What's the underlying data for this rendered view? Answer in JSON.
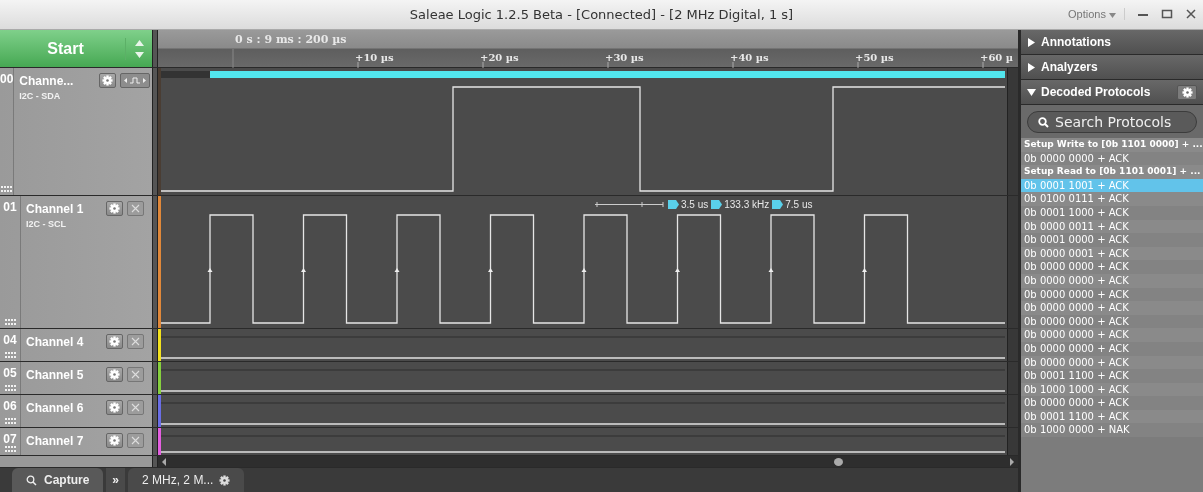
{
  "window": {
    "title": "Saleae Logic 1.2.5 Beta - [Connected] - [2 MHz Digital, 1 s]",
    "options": "Options"
  },
  "start_button": "Start",
  "timeline": {
    "origin": "0 s : 9 ms : 200 µs",
    "ticks": [
      "+10 µs",
      "+20 µs",
      "+30 µs",
      "+40 µs",
      "+50 µs",
      "+60 µ"
    ]
  },
  "channels": [
    {
      "number": "00",
      "name": "Channe...",
      "protocol": "I2C - SDA",
      "kind": "trigger",
      "color": "#4a3d33"
    },
    {
      "number": "01",
      "name": "Channel 1",
      "protocol": "I2C - SCL",
      "kind": "close",
      "color": "#e0883a"
    },
    {
      "number": "04",
      "name": "Channel 4",
      "kind": "close",
      "color": "#f2e21e"
    },
    {
      "number": "05",
      "name": "Channel 5",
      "kind": "close",
      "color": "#86d03e"
    },
    {
      "number": "06",
      "name": "Channel 6",
      "kind": "close",
      "color": "#6a6ee6"
    },
    {
      "number": "07",
      "name": "Channel 7",
      "kind": "close",
      "color": "#e45fe0"
    }
  ],
  "measurement": [
    "3.5 us",
    "133.3 kHz",
    "7.5 us"
  ],
  "panels": [
    {
      "title": "Annotations",
      "expanded": false
    },
    {
      "title": "Analyzers",
      "expanded": false
    },
    {
      "title": "Decoded Protocols",
      "expanded": true
    }
  ],
  "search": {
    "placeholder": "Search Protocols"
  },
  "decoded": [
    {
      "text": "Setup Write to [0b 1101 0000] + ...",
      "kind": "setup",
      "selected": false
    },
    {
      "text": "0b 0000 0000 + ACK",
      "kind": "byte",
      "selected": false
    },
    {
      "text": "Setup Read to [0b 1101 0001] + ...",
      "kind": "setup",
      "selected": false
    },
    {
      "text": "0b 0001 1001 + ACK",
      "kind": "byte",
      "selected": true
    },
    {
      "text": "0b 0100 0111 + ACK",
      "kind": "byte",
      "selected": false
    },
    {
      "text": "0b 0001 1000 + ACK",
      "kind": "byte",
      "selected": false
    },
    {
      "text": "0b 0000 0011 + ACK",
      "kind": "byte",
      "selected": false
    },
    {
      "text": "0b 0001 0000 + ACK",
      "kind": "byte",
      "selected": false
    },
    {
      "text": "0b 0000 0001 + ACK",
      "kind": "byte",
      "selected": false
    },
    {
      "text": "0b 0000 0000 + ACK",
      "kind": "byte",
      "selected": false
    },
    {
      "text": "0b 0000 0000 + ACK",
      "kind": "byte",
      "selected": false
    },
    {
      "text": "0b 0000 0000 + ACK",
      "kind": "byte",
      "selected": false
    },
    {
      "text": "0b 0000 0000 + ACK",
      "kind": "byte",
      "selected": false
    },
    {
      "text": "0b 0000 0000 + ACK",
      "kind": "byte",
      "selected": false
    },
    {
      "text": "0b 0000 0000 + ACK",
      "kind": "byte",
      "selected": false
    },
    {
      "text": "0b 0000 0000 + ACK",
      "kind": "byte",
      "selected": false
    },
    {
      "text": "0b 0000 0000 + ACK",
      "kind": "byte",
      "selected": false
    },
    {
      "text": "0b 0001 1100 + ACK",
      "kind": "byte",
      "selected": false
    },
    {
      "text": "0b 1000 1000 + ACK",
      "kind": "byte",
      "selected": false
    },
    {
      "text": "0b 0000 0000 + ACK",
      "kind": "byte",
      "selected": false
    },
    {
      "text": "0b 0001 1100 + ACK",
      "kind": "byte",
      "selected": false
    },
    {
      "text": "0b 1000 0000 + NAK",
      "kind": "byte",
      "selected": false
    }
  ],
  "bottom_tabs": [
    {
      "label": "Capture",
      "selected": true
    },
    {
      "label": "2 MHz, 2 M...",
      "selected": false
    }
  ],
  "more_tabs": "»"
}
